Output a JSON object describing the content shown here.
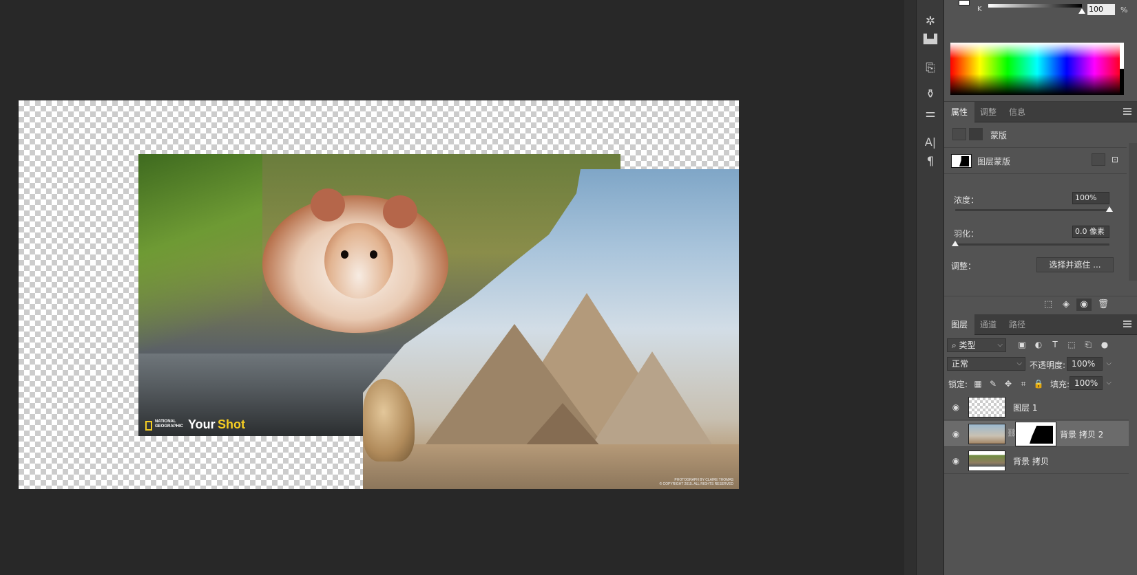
{
  "canvas": {
    "natgeo_text": "NATIONAL GEOGRAPHIC",
    "yourshot_your": "Your",
    "yourshot_shot": "Shot",
    "photo_credit_line1": "PHOTOGRAPH BY CLAIRE THOMAS",
    "photo_credit_line2": "© COPYRIGHT 2015. ALL RIGHTS RESERVED"
  },
  "color_panel": {
    "k_label": "K",
    "k_value": "100",
    "k_unit": "%"
  },
  "dock": {
    "icons": [
      "compass-icon",
      "histogram-icon",
      "brush-settings-icon",
      "clone-source-icon",
      "adjustments-icon",
      "character-icon",
      "paragraph-icon"
    ],
    "character_glyph": "A|",
    "paragraph_glyph": "¶"
  },
  "properties": {
    "tabs": [
      "属性",
      "调整",
      "信息"
    ],
    "active_tab": "属性",
    "mask_section_label": "蒙版",
    "layer_mask_label": "图层蒙版",
    "density_label": "浓度：",
    "density_value": "100%",
    "density_level": 1.0,
    "feather_label": "羽化：",
    "feather_value": "0.0 像素",
    "feather_level": 0.0,
    "refine_label": "调整：",
    "select_mask_button": "选择并遮住 ..."
  },
  "layers": {
    "tabs": [
      "图层",
      "通道",
      "路径"
    ],
    "active_tab": "图层",
    "filter_kind": "类型",
    "blend_mode": "正常",
    "opacity_label": "不透明度:",
    "opacity_value": "100%",
    "lock_label": "锁定:",
    "fill_label": "填充:",
    "fill_value": "100%",
    "items": [
      {
        "name": "图层 1",
        "visible": true,
        "selected": false
      },
      {
        "name": "背景 拷贝 2",
        "visible": true,
        "selected": true,
        "has_mask": true
      },
      {
        "name": "背景 拷贝",
        "visible": true,
        "selected": false
      }
    ]
  },
  "colors": {
    "workspace_bg": "#282828",
    "panel_bg": "#535353",
    "tabbar_bg": "#3d3d3d",
    "selected_layer_bg": "#6b6b6b",
    "natgeo_yellow": "#f5cd22"
  }
}
